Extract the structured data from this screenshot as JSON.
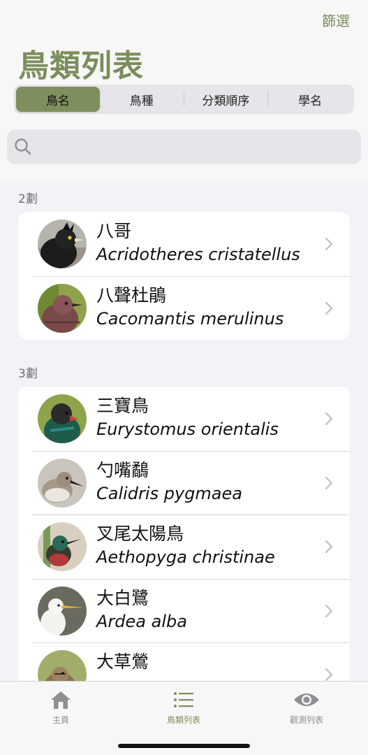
{
  "header": {
    "filter_label": "篩選",
    "title": "鳥類列表"
  },
  "segments": [
    {
      "label": "鳥名",
      "active": true
    },
    {
      "label": "鳥種",
      "active": false
    },
    {
      "label": "分類順序",
      "active": false
    },
    {
      "label": "學名",
      "active": false
    }
  ],
  "search": {
    "placeholder": "",
    "value": "",
    "icon": "search-icon"
  },
  "sections": [
    {
      "header": "2劃",
      "items": [
        {
          "zh": "八哥",
          "sci": "Acridotheres cristatellus"
        },
        {
          "zh": "八聲杜鵑",
          "sci": "Cacomantis merulinus"
        }
      ]
    },
    {
      "header": "3劃",
      "items": [
        {
          "zh": "三寶鳥",
          "sci": "Eurystomus orientalis"
        },
        {
          "zh": "勺嘴鷸",
          "sci": "Calidris pygmaea"
        },
        {
          "zh": "叉尾太陽鳥",
          "sci": "Aethopyga christinae"
        },
        {
          "zh": "大白鷺",
          "sci": "Ardea alba"
        },
        {
          "zh": "大草鶯",
          "sci": ""
        }
      ]
    }
  ],
  "tab_bar": {
    "items": [
      {
        "label": "主頁",
        "icon": "house-icon",
        "active": false
      },
      {
        "label": "鳥類列表",
        "icon": "list-icon",
        "active": true
      },
      {
        "label": "觀測列表",
        "icon": "eye-icon",
        "active": false
      }
    ]
  },
  "colors": {
    "accent": "#7b8e5b",
    "tab_inactive": "#8e8e93"
  }
}
